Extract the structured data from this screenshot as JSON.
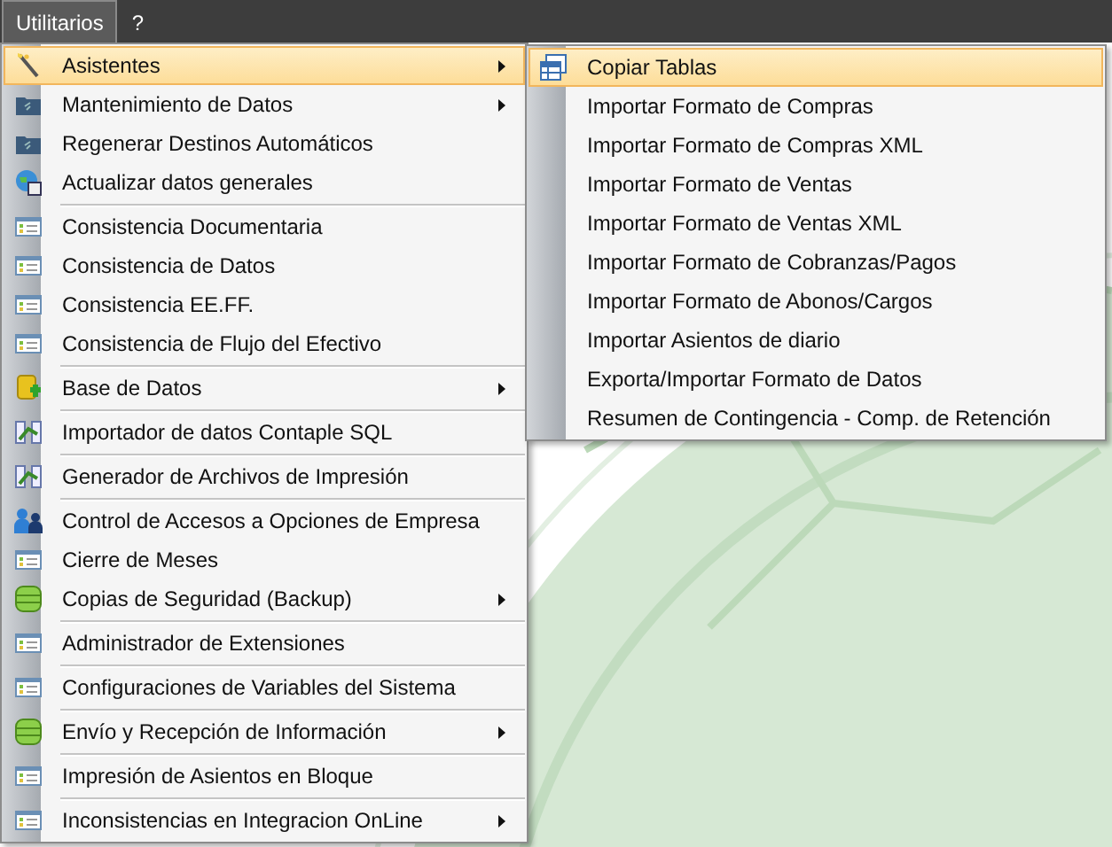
{
  "menubar": [
    {
      "label": "Utilitarios",
      "selected": true
    },
    {
      "label": "?",
      "selected": false
    }
  ],
  "menu": {
    "groups": [
      {
        "items": [
          {
            "label": "Asistentes",
            "kind": "wand",
            "submenu": true,
            "selected": true
          },
          {
            "label": "Mantenimiento de Datos",
            "kind": "folder",
            "submenu": true,
            "selected": false
          },
          {
            "label": "Regenerar Destinos Automáticos",
            "kind": "folder",
            "submenu": false,
            "selected": false
          },
          {
            "label": "Actualizar datos generales",
            "kind": "globe",
            "submenu": false,
            "selected": false
          }
        ]
      },
      {
        "items": [
          {
            "label": "Consistencia Documentaria",
            "kind": "form",
            "submenu": false,
            "selected": false
          },
          {
            "label": "Consistencia de Datos",
            "kind": "form",
            "submenu": false,
            "selected": false
          },
          {
            "label": "Consistencia EE.FF.",
            "kind": "form",
            "submenu": false,
            "selected": false
          },
          {
            "label": "Consistencia de Flujo del Efectivo",
            "kind": "form",
            "submenu": false,
            "selected": false
          }
        ]
      },
      {
        "items": [
          {
            "label": "Base de Datos",
            "kind": "dbadd",
            "submenu": true,
            "selected": false
          }
        ]
      },
      {
        "items": [
          {
            "label": "Importador de datos Contaple SQL",
            "kind": "chart",
            "submenu": false,
            "selected": false
          }
        ]
      },
      {
        "items": [
          {
            "label": "Generador de Archivos de Impresión",
            "kind": "chart",
            "submenu": false,
            "selected": false
          }
        ]
      },
      {
        "items": [
          {
            "label": "Control de Accesos a Opciones de Empresa",
            "kind": "users",
            "submenu": false,
            "selected": false
          },
          {
            "label": "Cierre de Meses",
            "kind": "form",
            "submenu": false,
            "selected": false
          },
          {
            "label": "Copias de Seguridad (Backup)",
            "kind": "database",
            "submenu": true,
            "selected": false
          }
        ]
      },
      {
        "items": [
          {
            "label": "Administrador de Extensiones",
            "kind": "form",
            "submenu": false,
            "selected": false
          }
        ]
      },
      {
        "items": [
          {
            "label": "Configuraciones de Variables del Sistema",
            "kind": "form",
            "submenu": false,
            "selected": false
          }
        ]
      },
      {
        "items": [
          {
            "label": "Envío y Recepción de Información",
            "kind": "database",
            "submenu": true,
            "selected": false
          }
        ]
      },
      {
        "items": [
          {
            "label": "Impresión de Asientos en Bloque",
            "kind": "form",
            "submenu": false,
            "selected": false
          }
        ]
      },
      {
        "items": [
          {
            "label": "Inconsistencias en Integracion OnLine",
            "kind": "form",
            "submenu": true,
            "selected": false
          }
        ]
      }
    ]
  },
  "submenu": {
    "items": [
      {
        "label": "Copiar Tablas",
        "kind": "table",
        "selected": true
      },
      {
        "label": "Importar Formato de Compras",
        "kind": "plain",
        "selected": false
      },
      {
        "label": "Importar Formato de Compras XML",
        "kind": "plain",
        "selected": false
      },
      {
        "label": "Importar Formato de Ventas",
        "kind": "plain",
        "selected": false
      },
      {
        "label": "Importar Formato de Ventas XML",
        "kind": "plain",
        "selected": false
      },
      {
        "label": "Importar Formato de Cobranzas/Pagos",
        "kind": "plain",
        "selected": false
      },
      {
        "label": "Importar Formato de Abonos/Cargos",
        "kind": "plain",
        "selected": false
      },
      {
        "label": "Importar Asientos de diario",
        "kind": "plain",
        "selected": false
      },
      {
        "label": "Exporta/Importar Formato de Datos",
        "kind": "plain",
        "selected": false
      },
      {
        "label": "Resumen de Contingencia - Comp. de Retención",
        "kind": "plain",
        "selected": false
      }
    ]
  }
}
